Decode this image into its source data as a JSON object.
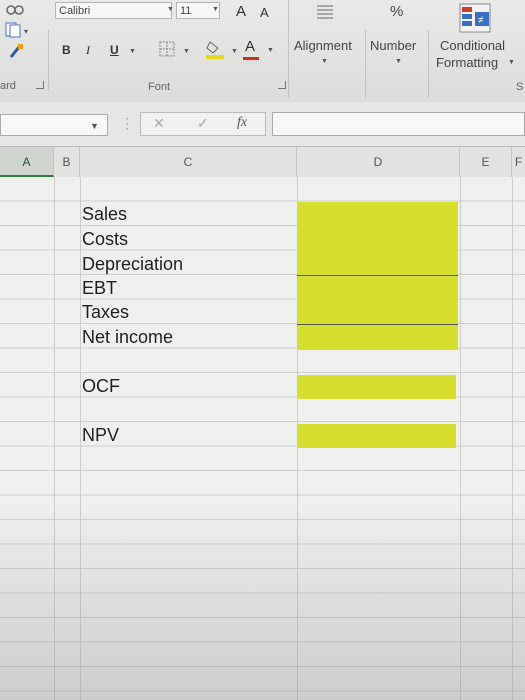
{
  "ribbon": {
    "font_name": "Calibri",
    "font_size": "11",
    "grow_font": "A",
    "shrink_font": "A",
    "bold": "B",
    "italic": "I",
    "underline": "U",
    "font_color_letter": "A",
    "percent": "%",
    "alignment_label": "Alignment",
    "number_label": "Number",
    "conditional_label_line1": "Conditional",
    "conditional_label_line2": "Formatting",
    "clipboard_group_label": "ard",
    "font_group_label": "Font",
    "styles_group_label": "S",
    "accent_fill_color": "#e8d81a",
    "accent_font_color": "#d03020"
  },
  "formula_bar": {
    "fx_label": "fx",
    "cancel_glyph": "✕",
    "enter_glyph": "✓",
    "name_box_value": "",
    "formula_value": ""
  },
  "columns": [
    "A",
    "B",
    "C",
    "D",
    "E",
    "F"
  ],
  "active_column": "A",
  "sheet": {
    "labels": [
      "Sales",
      "Costs",
      "Depreciation",
      "EBT",
      "Taxes",
      "Net income",
      "OCF",
      "NPV"
    ],
    "highlight_color": "#d7df2e"
  }
}
